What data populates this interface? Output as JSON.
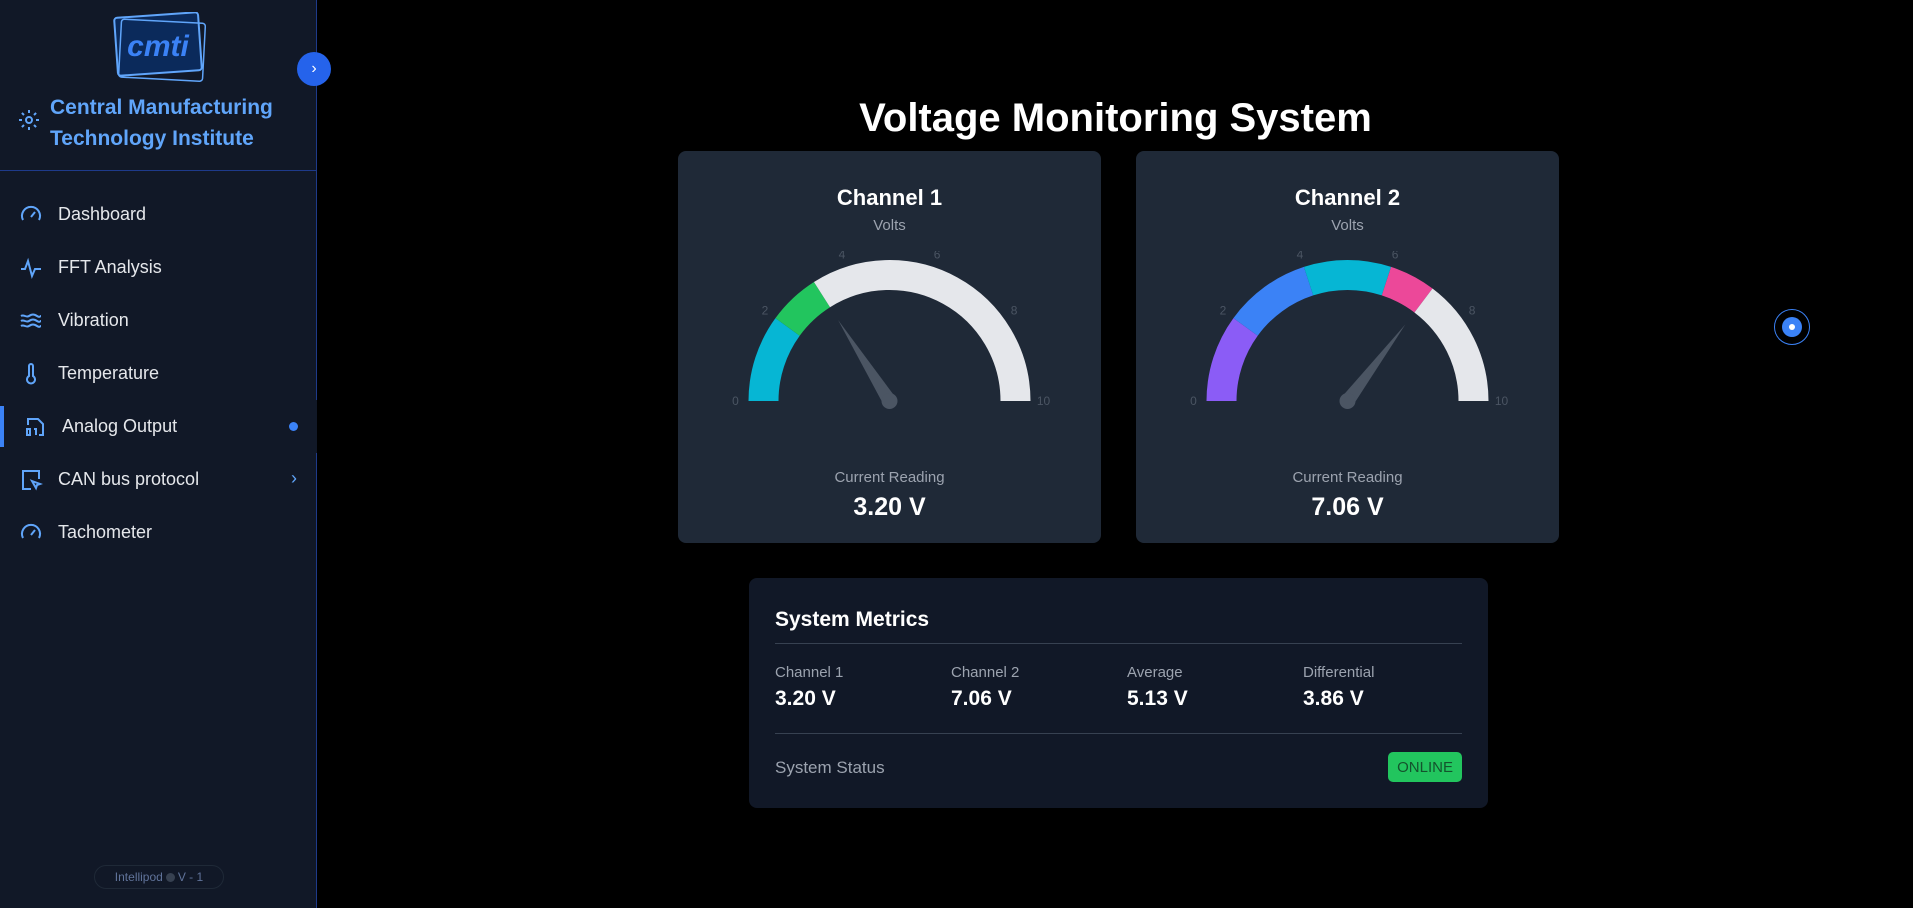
{
  "sidebar": {
    "brand_name": "Central Manufacturing Technology Institute",
    "logo_text": "cmti",
    "collapse_icon": "›",
    "items": [
      {
        "label": "Dashboard",
        "icon": "dashboard-gauge-icon"
      },
      {
        "label": "FFT Analysis",
        "icon": "pulse-icon"
      },
      {
        "label": "Vibration",
        "icon": "waves-icon"
      },
      {
        "label": "Temperature",
        "icon": "thermometer-icon"
      },
      {
        "label": "Analog Output",
        "icon": "binary-file-icon",
        "active": true
      },
      {
        "label": "CAN bus protocol",
        "icon": "cursor-square-icon",
        "chevron": "›"
      },
      {
        "label": "Tachometer",
        "icon": "gauge-icon"
      }
    ],
    "version": {
      "left": "Intellipod",
      "right": "V - 1"
    }
  },
  "main": {
    "title": "Voltage Monitoring System",
    "channels": [
      {
        "title": "Channel 1",
        "unit": "Volts",
        "reading_label": "Current Reading",
        "reading": "3.20 V",
        "value": 3.2,
        "ticks": [
          "0",
          "2",
          "4",
          "6",
          "8",
          "10"
        ],
        "segments": [
          {
            "from": 0,
            "to": 2,
            "color": "#06b6d4"
          },
          {
            "from": 2,
            "to": 3.2,
            "color": "#22c55e"
          },
          {
            "from": 3.2,
            "to": 10,
            "color": "#e5e7eb"
          }
        ]
      },
      {
        "title": "Channel 2",
        "unit": "Volts",
        "reading_label": "Current Reading",
        "reading": "7.06 V",
        "value": 7.06,
        "ticks": [
          "0",
          "2",
          "4",
          "6",
          "8",
          "10"
        ],
        "segments": [
          {
            "from": 0,
            "to": 2,
            "color": "#8b5cf6"
          },
          {
            "from": 2,
            "to": 4,
            "color": "#3b82f6"
          },
          {
            "from": 4,
            "to": 6,
            "color": "#06b6d4"
          },
          {
            "from": 6,
            "to": 7.06,
            "color": "#ec4899"
          },
          {
            "from": 7.06,
            "to": 10,
            "color": "#e5e7eb"
          }
        ]
      }
    ],
    "gauge_range": [
      0,
      10
    ],
    "needle_color": "#4b5563",
    "metrics": {
      "title": "System Metrics",
      "items": [
        {
          "label": "Channel 1",
          "value": "3.20 V"
        },
        {
          "label": "Channel 2",
          "value": "7.06 V"
        },
        {
          "label": "Average",
          "value": "5.13 V"
        },
        {
          "label": "Differential",
          "value": "3.86 V"
        }
      ],
      "status_label": "System Status",
      "status": "ONLINE"
    }
  }
}
